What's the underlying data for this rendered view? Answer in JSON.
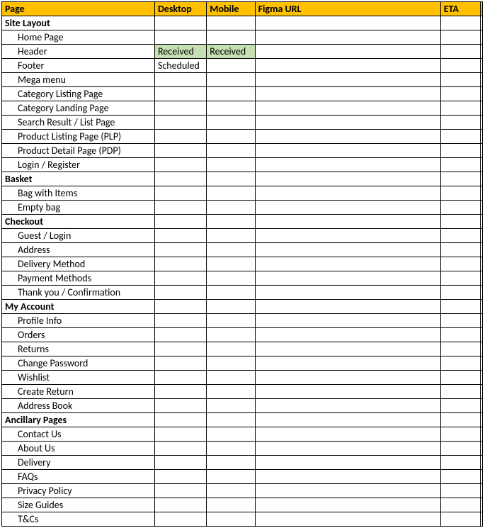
{
  "headers": {
    "page": "Page",
    "desktop": "Desktop",
    "mobile": "Mobile",
    "figma": "Figma URL",
    "eta": "ETA"
  },
  "rows": [
    {
      "type": "section",
      "label": "Site Layout"
    },
    {
      "type": "item",
      "label": "Home Page",
      "desktop": "",
      "mobile": ""
    },
    {
      "type": "item",
      "label": "Header",
      "desktop": "Received",
      "mobile": "Received",
      "desktop_status": "received",
      "mobile_status": "received"
    },
    {
      "type": "item",
      "label": "Footer",
      "desktop": "Scheduled",
      "mobile": ""
    },
    {
      "type": "item",
      "label": "Mega menu",
      "desktop": "",
      "mobile": ""
    },
    {
      "type": "item",
      "label": "Category Listing Page",
      "desktop": "",
      "mobile": ""
    },
    {
      "type": "item",
      "label": "Category Landing Page",
      "desktop": "",
      "mobile": ""
    },
    {
      "type": "item",
      "label": "Search Result / List Page",
      "desktop": "",
      "mobile": ""
    },
    {
      "type": "item",
      "label": "Product Listing Page (PLP)",
      "desktop": "",
      "mobile": ""
    },
    {
      "type": "item",
      "label": "Product Detail Page (PDP)",
      "desktop": "",
      "mobile": ""
    },
    {
      "type": "item",
      "label": "Login / Register",
      "desktop": "",
      "mobile": ""
    },
    {
      "type": "section",
      "label": "Basket"
    },
    {
      "type": "item",
      "label": "Bag with Items",
      "desktop": "",
      "mobile": ""
    },
    {
      "type": "item",
      "label": "Empty bag",
      "desktop": "",
      "mobile": ""
    },
    {
      "type": "section",
      "label": "Checkout"
    },
    {
      "type": "item",
      "label": "Guest / Login",
      "desktop": "",
      "mobile": ""
    },
    {
      "type": "item",
      "label": "Address",
      "desktop": "",
      "mobile": ""
    },
    {
      "type": "item",
      "label": "Delivery Method",
      "desktop": "",
      "mobile": ""
    },
    {
      "type": "item",
      "label": "Payment Methods",
      "desktop": "",
      "mobile": ""
    },
    {
      "type": "item",
      "label": "Thank you / Confirmation",
      "desktop": "",
      "mobile": ""
    },
    {
      "type": "section",
      "label": "My Account"
    },
    {
      "type": "item",
      "label": "Profile Info",
      "desktop": "",
      "mobile": ""
    },
    {
      "type": "item",
      "label": "Orders",
      "desktop": "",
      "mobile": ""
    },
    {
      "type": "item",
      "label": "Returns",
      "desktop": "",
      "mobile": ""
    },
    {
      "type": "item",
      "label": "Change Password",
      "desktop": "",
      "mobile": ""
    },
    {
      "type": "item",
      "label": "Wishlist",
      "desktop": "",
      "mobile": ""
    },
    {
      "type": "item",
      "label": "Create Return",
      "desktop": "",
      "mobile": ""
    },
    {
      "type": "item",
      "label": "Address Book",
      "desktop": "",
      "mobile": ""
    },
    {
      "type": "section",
      "label": "Ancillary Pages"
    },
    {
      "type": "item",
      "label": "Contact Us",
      "desktop": "",
      "mobile": ""
    },
    {
      "type": "item",
      "label": "About Us",
      "desktop": "",
      "mobile": ""
    },
    {
      "type": "item",
      "label": "Delivery",
      "desktop": "",
      "mobile": ""
    },
    {
      "type": "item",
      "label": "FAQs",
      "desktop": "",
      "mobile": ""
    },
    {
      "type": "item",
      "label": "Privacy Policy",
      "desktop": "",
      "mobile": ""
    },
    {
      "type": "item",
      "label": "Size Guides",
      "desktop": "",
      "mobile": ""
    },
    {
      "type": "item",
      "label": "T&Cs",
      "desktop": "",
      "mobile": ""
    }
  ]
}
